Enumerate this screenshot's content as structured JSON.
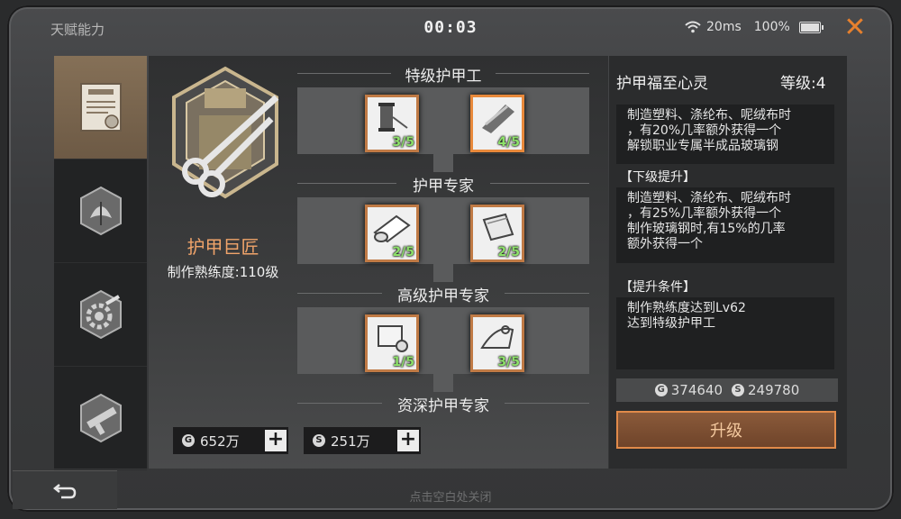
{
  "header": {
    "title": "天赋能力",
    "timer": "00:03",
    "network": "20ms",
    "battery": "100%"
  },
  "tabs": [
    {
      "icon": "certificate-icon",
      "active": true
    },
    {
      "icon": "leaf-emblem-icon",
      "active": false
    },
    {
      "icon": "gear-tools-icon",
      "active": false
    },
    {
      "icon": "weapon-icon",
      "active": false
    }
  ],
  "skill": {
    "emblem": "armor-scissors-icon",
    "name": "护甲巨匠",
    "level_text": "制作熟练度:110级"
  },
  "tiers": [
    {
      "label": "特级护甲工",
      "items": [
        {
          "icon": "thread-spool-icon",
          "progress": "3/5"
        },
        {
          "icon": "cloth-roll-icon",
          "progress": "4/5"
        }
      ]
    },
    {
      "label": "护甲专家",
      "items": [
        {
          "icon": "fabric-roll-icon",
          "progress": "2/5"
        },
        {
          "icon": "fabric-sheet-icon",
          "progress": "2/5"
        }
      ]
    },
    {
      "label": "高级护甲专家",
      "items": [
        {
          "icon": "canvas-roll-icon",
          "progress": "1/5"
        },
        {
          "icon": "cloth-fold-icon",
          "progress": "3/5"
        }
      ]
    },
    {
      "label": "资深护甲专家",
      "items": []
    }
  ],
  "currency": {
    "gold": "652万",
    "silver": "251万"
  },
  "detail": {
    "title": "护甲福至心灵",
    "level": "等级:4",
    "current_desc": [
      "制造塑料、涤纶布、呢绒布时",
      "，有20%几率额外获得一个",
      "解锁职业专属半成品玻璃钢"
    ],
    "next_head": "【下级提升】",
    "next_desc": [
      "制造塑料、涤纶布、呢绒布时",
      "，有25%几率额外获得一个",
      "制作玻璃钢时,有15%的几率",
      "额外获得一个"
    ],
    "cond_head": "【提升条件】",
    "cond_desc": [
      "制作熟练度达到Lv62",
      "达到特级护甲工"
    ],
    "cost_gold": "374640",
    "cost_silver": "249780",
    "upgrade_label": "升级"
  },
  "footer": {
    "hint": "点击空白处关闭"
  }
}
